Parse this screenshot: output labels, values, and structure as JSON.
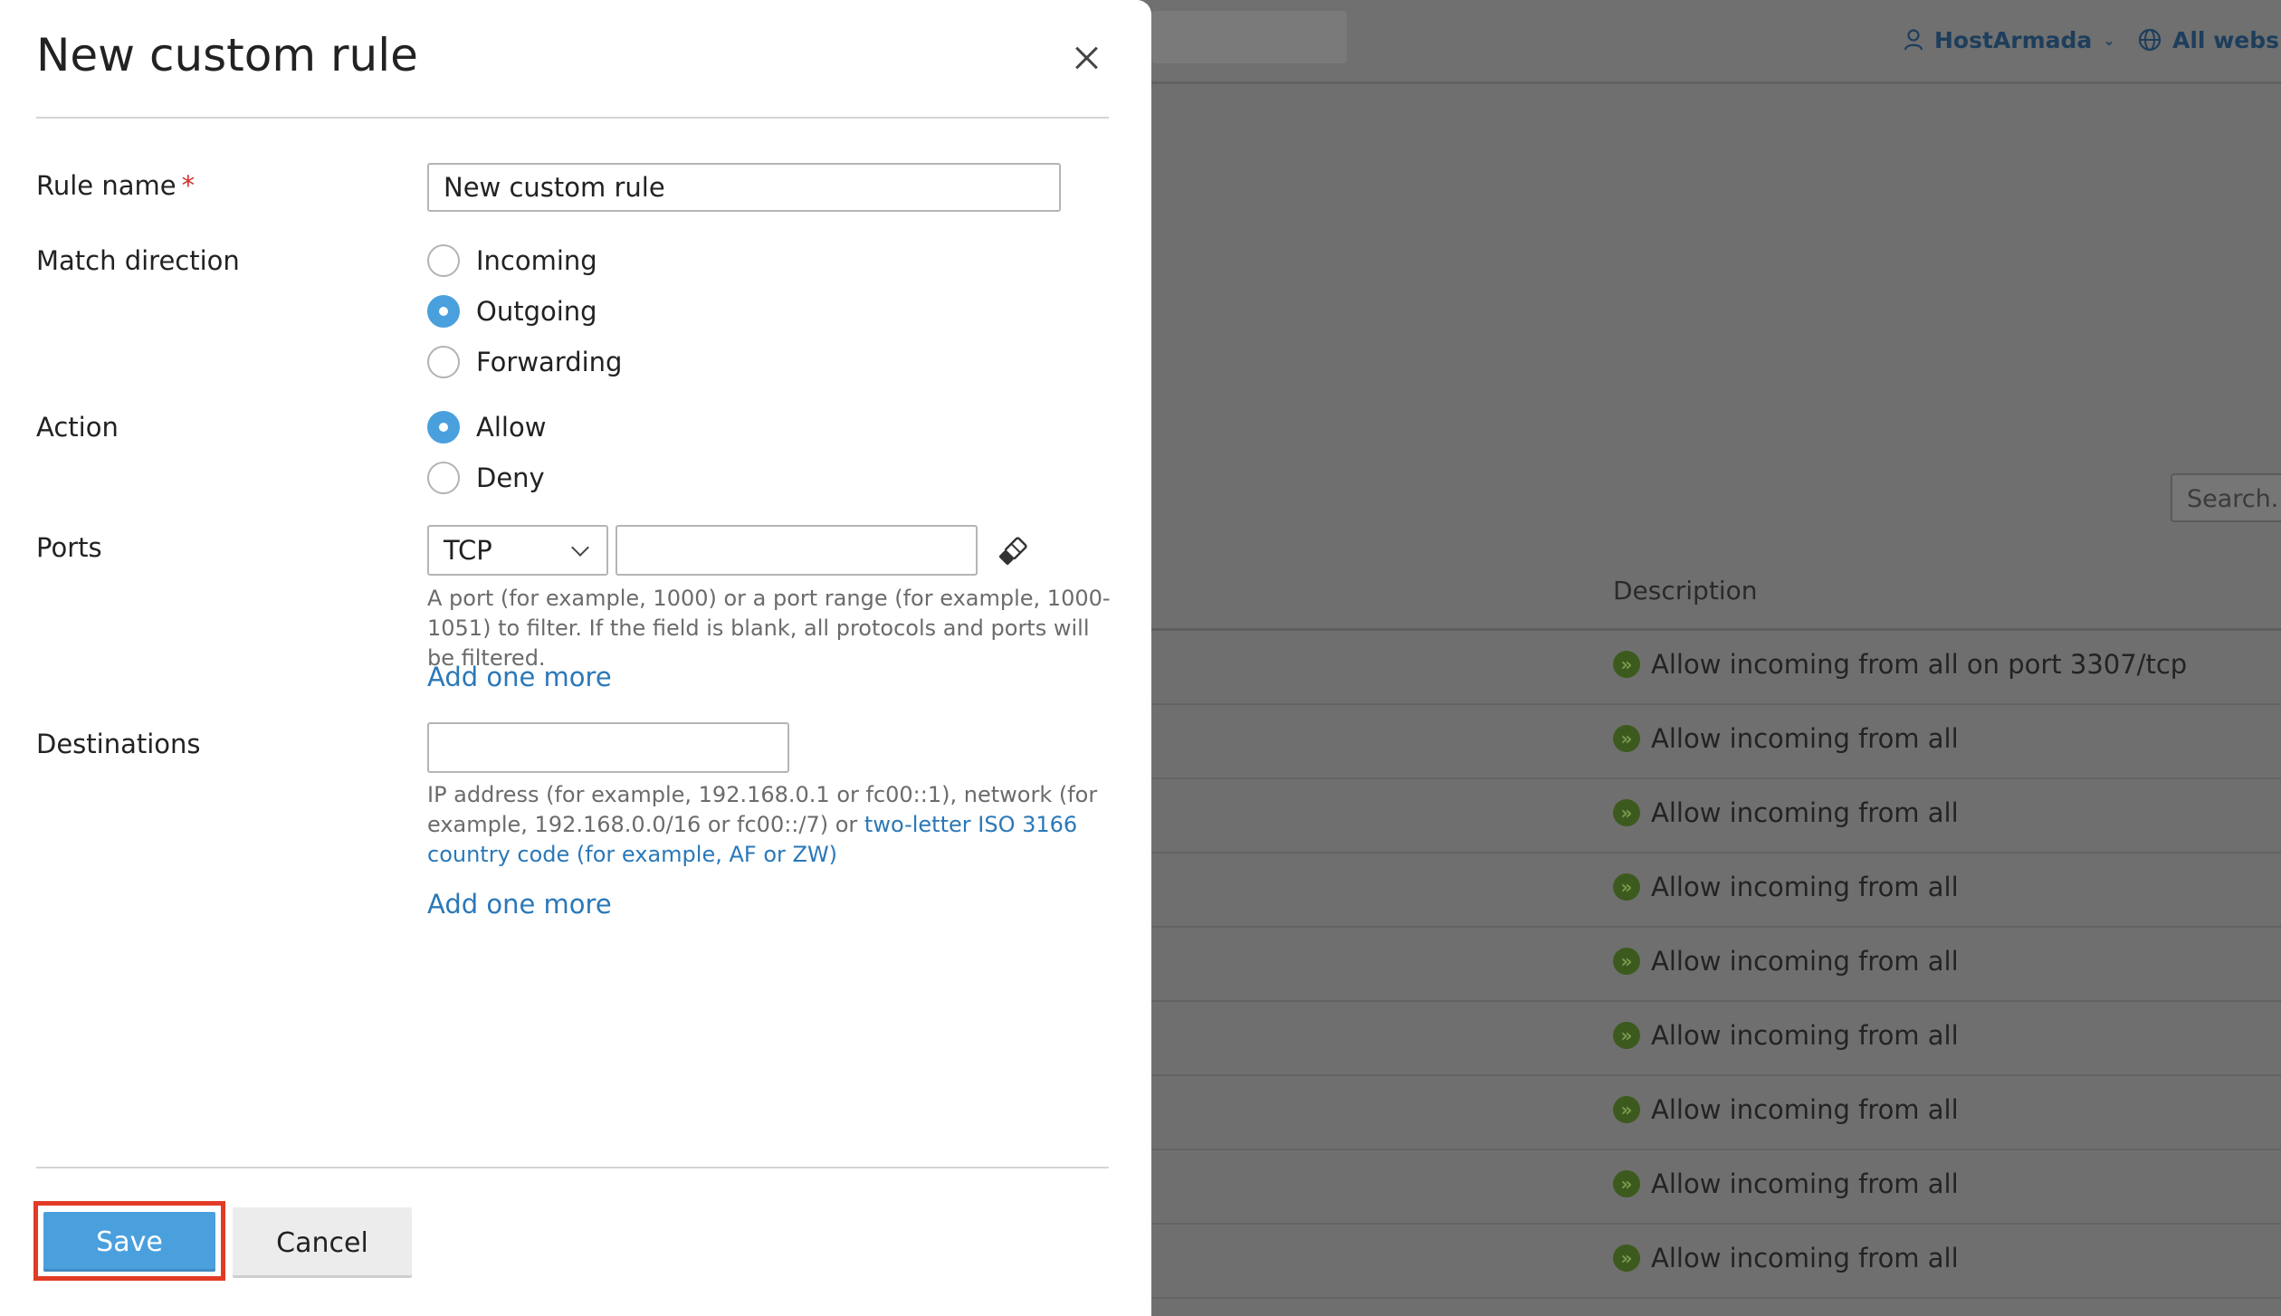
{
  "background": {
    "user_menu": "HostArmada",
    "webspaces_menu": "All webspa",
    "search_placeholder": "Search...",
    "table": {
      "description_header": "Description",
      "rows": [
        {
          "description": "Allow incoming from all on port 3307/tcp"
        },
        {
          "description": "Allow incoming from all"
        },
        {
          "description": "Allow incoming from all"
        },
        {
          "description": "Allow incoming from all"
        },
        {
          "description": "Allow incoming from all"
        },
        {
          "description": "Allow incoming from all"
        },
        {
          "description": "Allow incoming from all"
        },
        {
          "description": "Allow incoming from all"
        },
        {
          "description": "Allow incoming from all"
        }
      ]
    }
  },
  "dialog": {
    "title": "New custom rule",
    "rule_name": {
      "label": "Rule name",
      "required_mark": "*",
      "value": "New custom rule"
    },
    "match_direction": {
      "label": "Match direction",
      "options": [
        {
          "label": "Incoming",
          "checked": false
        },
        {
          "label": "Outgoing",
          "checked": true
        },
        {
          "label": "Forwarding",
          "checked": false
        }
      ]
    },
    "action": {
      "label": "Action",
      "options": [
        {
          "label": "Allow",
          "checked": true
        },
        {
          "label": "Deny",
          "checked": false
        }
      ]
    },
    "ports": {
      "label": "Ports",
      "protocol": "TCP",
      "port_value": "",
      "hint": "A port (for example, 1000) or a port range (for example, 1000-1051) to filter. If the field is blank, all protocols and ports will be filtered.",
      "add_more": "Add one more"
    },
    "destinations": {
      "label": "Destinations",
      "value": "",
      "hint_prefix": "IP address (for example, 192.168.0.1 or fc00::1), network (for example, 192.168.0.0/16 or fc00::/7) or ",
      "hint_link": "two-letter ISO 3166 country code (for example, AF or ZW)",
      "add_more": "Add one more"
    },
    "buttons": {
      "save": "Save",
      "cancel": "Cancel"
    }
  },
  "colors": {
    "accent": "#4aa0dd",
    "link": "#2a78b8",
    "highlight_border": "#e23b25",
    "required": "#d0312d",
    "overlay": "#6f6f6f"
  }
}
